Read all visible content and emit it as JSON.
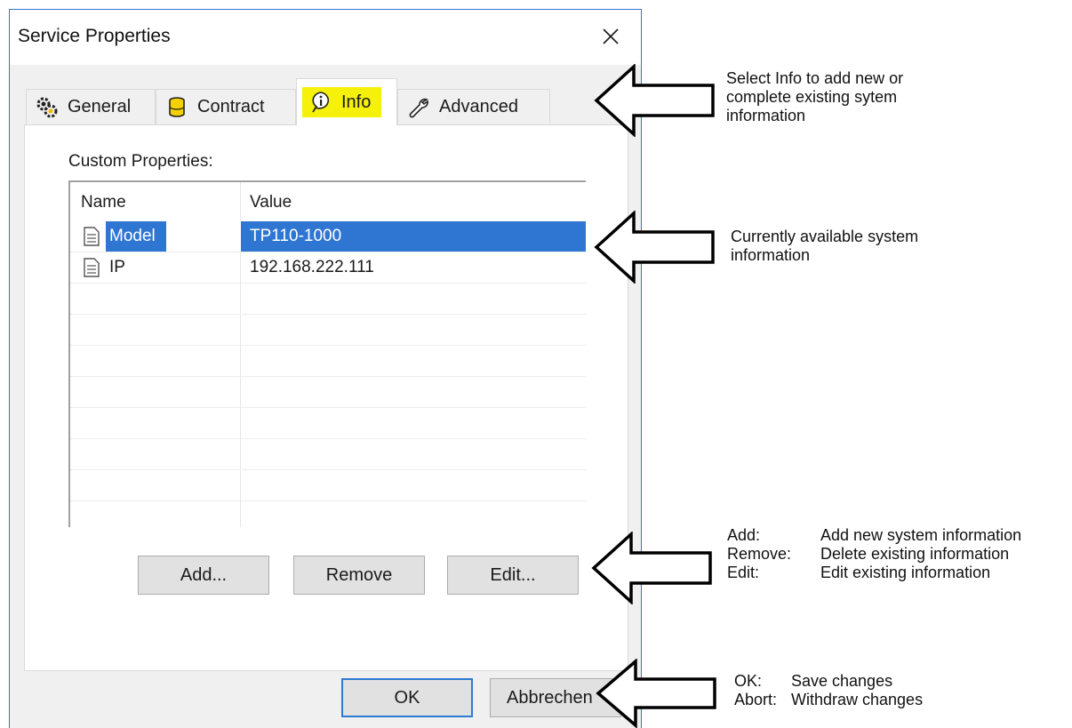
{
  "window": {
    "title": "Service Properties"
  },
  "tabs": [
    {
      "label": "General",
      "icon": "gears-icon"
    },
    {
      "label": "Contract",
      "icon": "database-icon"
    },
    {
      "label": "Info",
      "icon": "info-bubble-icon",
      "active": true,
      "highlight": "#f6f10a"
    },
    {
      "label": "Advanced",
      "icon": "wrench-icon"
    }
  ],
  "panel": {
    "section_label": "Custom Properties:",
    "columns": [
      "Name",
      "Value"
    ],
    "rows": [
      {
        "name": "Model",
        "value": "TP110-1000",
        "selected": true
      },
      {
        "name": "IP",
        "value": "192.168.222.111"
      }
    ],
    "buttons": {
      "add": "Add...",
      "remove": "Remove",
      "edit": "Edit..."
    }
  },
  "footer": {
    "ok": "OK",
    "cancel": "Abbrechen"
  },
  "annotations": {
    "info_tab": "Select Info to add new or complete existing sytem information",
    "list": "Currently available system information",
    "buttons": [
      {
        "key": "Add:",
        "text": "Add new system information"
      },
      {
        "key": "Remove:",
        "text": "Delete existing information"
      },
      {
        "key": "Edit:",
        "text": "Edit existing information"
      }
    ],
    "footer": [
      {
        "key": "OK:",
        "text": "Save changes"
      },
      {
        "key": "Abort:",
        "text": "Withdraw changes"
      }
    ]
  },
  "colors": {
    "selection": "#2f76d2",
    "window_border": "#2b7bd1",
    "highlight": "#f6f10a"
  }
}
